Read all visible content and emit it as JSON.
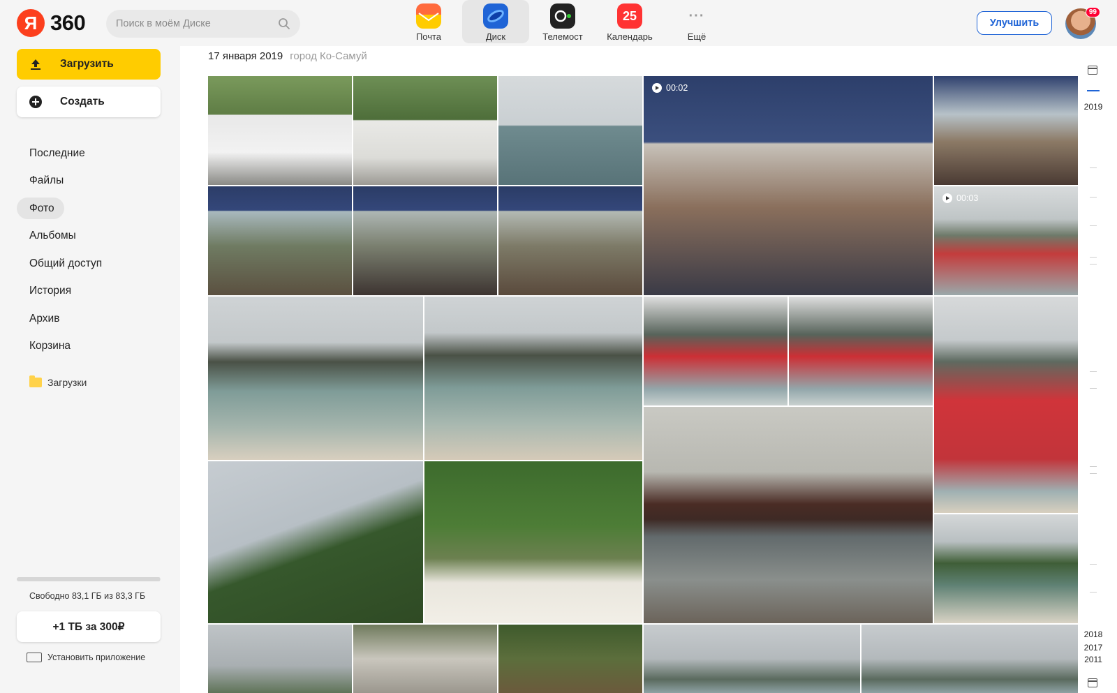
{
  "header": {
    "logo_letter": "Я",
    "logo_text": "360",
    "search_placeholder": "Поиск в моём Диске",
    "services": [
      {
        "label": "Почта",
        "icon": "mail-icon",
        "color": "#ffcc00"
      },
      {
        "label": "Диск",
        "icon": "disk-icon",
        "color": "#1f64d6",
        "active": true
      },
      {
        "label": "Телемост",
        "icon": "telemost-icon",
        "color": "#222222"
      },
      {
        "label": "Календарь",
        "icon": "calendar-icon",
        "color": "#f33",
        "badge": "25"
      },
      {
        "label": "Ещё",
        "icon": "more-icon",
        "color": "#999999"
      }
    ],
    "upgrade_label": "Улучшить",
    "avatar_badge": "99"
  },
  "sidebar": {
    "upload_label": "Загрузить",
    "create_label": "Создать",
    "nav": [
      "Последние",
      "Файлы",
      "Фото",
      "Альбомы",
      "Общий доступ",
      "История",
      "Архив",
      "Корзина"
    ],
    "active_nav": "Фото",
    "folder_label": "Загрузки",
    "storage_used_fraction": 0.997,
    "storage_text": "Свободно 83,1 ГБ из 83,3 ГБ",
    "tb_button_label": "+1 ТБ за 300₽",
    "install_label": "Установить приложение"
  },
  "content": {
    "date": "17 января 2019",
    "place": "город Ко-Самуй",
    "videos": [
      {
        "duration": "00:02"
      },
      {
        "duration": "00:03"
      }
    ]
  },
  "timeline": {
    "years": [
      "2019",
      "2018",
      "2017",
      "2011"
    ]
  },
  "colors": {
    "accent": "#ffcc00",
    "brand_blue": "#1f64d6",
    "brand_red": "#fc3f1d"
  }
}
